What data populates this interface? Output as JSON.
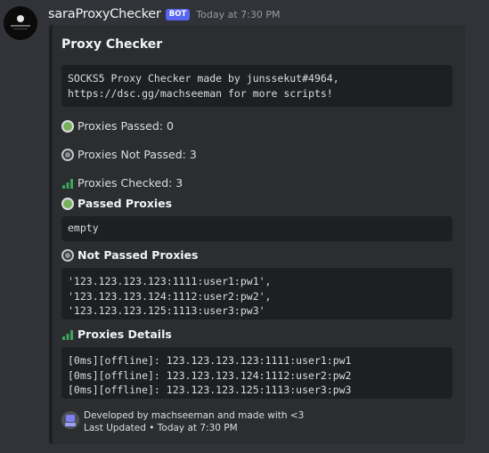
{
  "message": {
    "username": "saraProxyChecker",
    "bot_tag": "BOT",
    "timestamp": "Today at 7:30 PM",
    "avatar_icon": "bot-avatar"
  },
  "embed": {
    "border_color": "#1e1f22",
    "title": "Proxy Checker",
    "description_lines": [
      "SOCKS5 Proxy Checker made by junssekut#4964,",
      "https://dsc.gg/machseeman for more scripts!"
    ],
    "stats": [
      {
        "icon": "green-circle-icon",
        "label": "Proxies Passed: 0"
      },
      {
        "icon": "gray-radio-icon",
        "label": "Proxies Not Passed: 3"
      },
      {
        "icon": "signal-bars-icon",
        "label": "Proxies Checked: 3"
      }
    ],
    "fields": [
      {
        "icon": "green-circle-icon",
        "name": "Passed Proxies",
        "lines": [
          "empty"
        ]
      },
      {
        "icon": "gray-radio-icon",
        "name": "Not Passed Proxies",
        "lines": [
          "'123.123.123.123:1111:user1:pw1',",
          "'123.123.123.124:1112:user2:pw2',",
          "'123.123.123.125:1113:user3:pw3'"
        ]
      },
      {
        "icon": "signal-bars-icon",
        "name": "Proxies Details",
        "lines": [
          "[0ms][offline]: 123.123.123.123:1111:user1:pw1",
          "[0ms][offline]: 123.123.123.124:1112:user2:pw2",
          "[0ms][offline]: 123.123.123.125:1113:user3:pw3"
        ]
      }
    ],
    "footer": {
      "icon": "footer-logo-icon",
      "line1": "Developed by machseeman and made with <3",
      "line2": "Last Updated • Today at 7:30 PM"
    }
  },
  "colors": {
    "background": "#313338",
    "embed_background": "#2b2d31",
    "codeblock_background": "#1e1f22",
    "bot_tag": "#5865f2",
    "green_icon": "#78b159",
    "bars_icon": "#3ba55c"
  }
}
